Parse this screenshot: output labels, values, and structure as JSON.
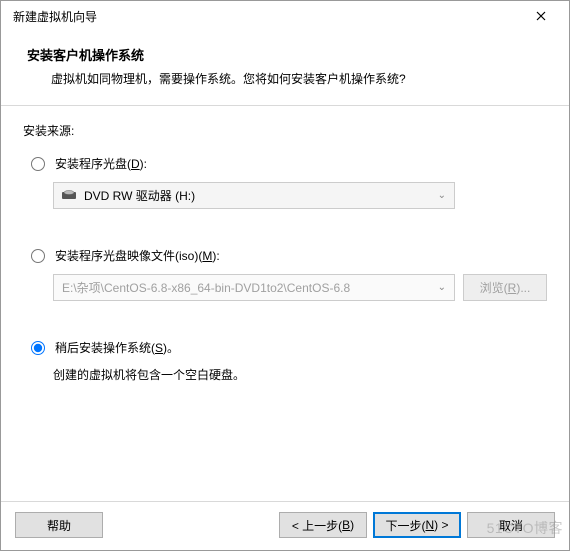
{
  "window": {
    "title": "新建虚拟机向导"
  },
  "header": {
    "title": "安装客户机操作系统",
    "desc": "虚拟机如同物理机，需要操作系统。您将如何安装客户机操作系统?"
  },
  "sourceLabel": "安装来源:",
  "option1": {
    "label_pre": "安装程序光盘(",
    "label_u": "D",
    "label_post": "):",
    "drive": "DVD RW 驱动器 (H:)"
  },
  "option2": {
    "label_pre": "安装程序光盘映像文件(iso)(",
    "label_u": "M",
    "label_post": "):",
    "path": "E:\\杂项\\CentOS-6.8-x86_64-bin-DVD1to2\\CentOS-6.8",
    "browse_pre": "浏览(",
    "browse_u": "R",
    "browse_post": ")..."
  },
  "option3": {
    "label_pre": "稍后安装操作系统(",
    "label_u": "S",
    "label_post": ")。",
    "note": "创建的虚拟机将包含一个空白硬盘。"
  },
  "footer": {
    "help": "帮助",
    "back_pre": "< 上一步(",
    "back_u": "B",
    "back_post": ")",
    "next_pre": "下一步(",
    "next_u": "N",
    "next_post": ") >",
    "cancel": "取消"
  },
  "watermark": "51CTO博客"
}
